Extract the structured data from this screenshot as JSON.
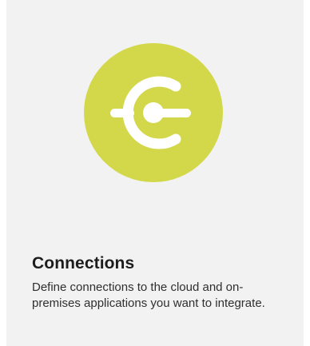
{
  "card": {
    "title": "Connections",
    "description": "Define connections to the cloud and on-premises applications you want to integrate.",
    "icon": "connector-plug-icon",
    "accent_color": "#d3d84a"
  }
}
